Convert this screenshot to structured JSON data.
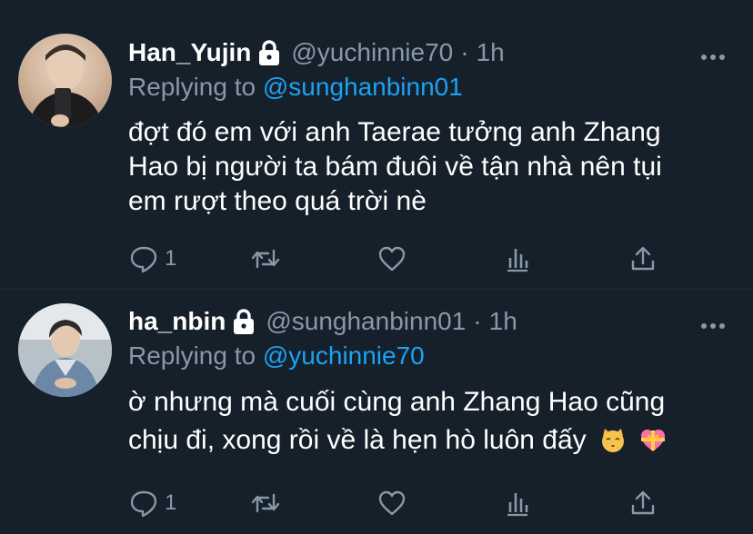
{
  "tweets": [
    {
      "display_name": "Han_Yujin",
      "handle": "@yuchinnie70",
      "separator": "·",
      "time": "1h",
      "replying_prefix": "Replying to",
      "replying_handle": "@sunghanbinn01",
      "text_lines": [
        "đợt đó em với anh Taerae tưởng anh Zhang",
        "Hao bị người ta bám đuôi về tận nhà nên tụi",
        "em rượt theo quá trời nè"
      ],
      "reply_count": "1",
      "avatar_icon": "avatar-photo",
      "lock_icon": "lock-icon"
    },
    {
      "display_name": "ha_nbin",
      "handle": "@sunghanbinn01",
      "separator": "·",
      "time": "1h",
      "replying_prefix": "Replying to",
      "replying_handle": "@yuchinnie70",
      "text_lines": [
        "ờ nhưng mà cuối cùng anh Zhang Hao cũng",
        "chịu đi, xong rồi về là hẹn hò luôn đấy"
      ],
      "emojis": [
        "kissing-cat-emoji",
        "heart-with-ribbon-emoji"
      ],
      "reply_count": "1",
      "avatar_icon": "avatar-photo",
      "lock_icon": "lock-icon"
    }
  ],
  "colors": {
    "background": "#15202b",
    "text": "#ffffff",
    "muted": "#8899a6",
    "link": "#1da1f2"
  },
  "action_icons": [
    "reply-icon",
    "retweet-icon",
    "like-icon",
    "analytics-icon",
    "share-icon"
  ]
}
